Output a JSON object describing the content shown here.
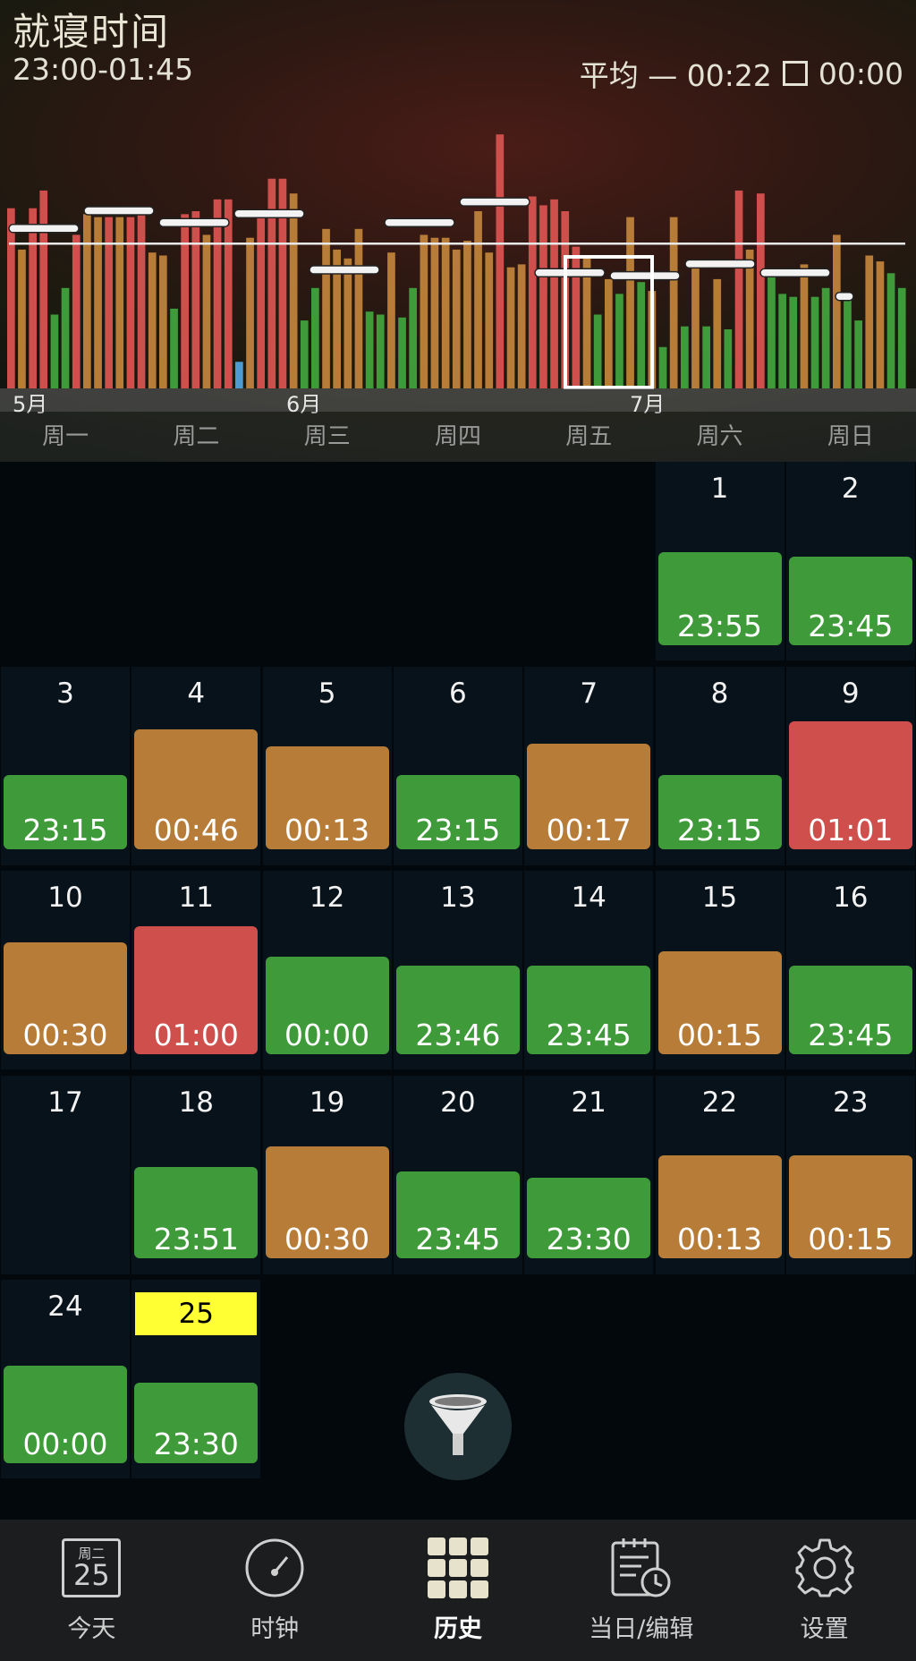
{
  "header": {
    "title": "就寝时间",
    "range": "23:00-01:45",
    "avg_label": "平均 — 00:22",
    "avg_check_value": "00:00"
  },
  "chart_data": {
    "type": "bar",
    "months": [
      "5月",
      "6月",
      "7月"
    ],
    "colors": {
      "green": "#3f9b3a",
      "orange": "#b67c38",
      "red": "#cf4f4c",
      "blue": "#4d9bd0"
    },
    "series": [
      {
        "c": "r",
        "v": 0.61
      },
      {
        "c": "o",
        "v": 0.47
      },
      {
        "c": "r",
        "v": 0.61
      },
      {
        "c": "r",
        "v": 0.67
      },
      {
        "c": "g",
        "v": 0.25
      },
      {
        "c": "g",
        "v": 0.34
      },
      {
        "c": "r",
        "v": 0.52
      },
      {
        "c": "o",
        "v": 0.59
      },
      {
        "c": "o",
        "v": 0.58
      },
      {
        "c": "r",
        "v": 0.58
      },
      {
        "c": "o",
        "v": 0.58
      },
      {
        "c": "r",
        "v": 0.58
      },
      {
        "c": "r",
        "v": 0.59
      },
      {
        "c": "o",
        "v": 0.46
      },
      {
        "c": "o",
        "v": 0.45
      },
      {
        "c": "g",
        "v": 0.27
      },
      {
        "c": "r",
        "v": 0.59
      },
      {
        "c": "r",
        "v": 0.6
      },
      {
        "c": "o",
        "v": 0.52
      },
      {
        "c": "r",
        "v": 0.64
      },
      {
        "c": "r",
        "v": 0.64
      },
      {
        "c": "b",
        "v": 0.09
      },
      {
        "c": "o",
        "v": 0.51
      },
      {
        "c": "r",
        "v": 0.58
      },
      {
        "c": "r",
        "v": 0.71
      },
      {
        "c": "r",
        "v": 0.71
      },
      {
        "c": "o",
        "v": 0.66
      },
      {
        "c": "g",
        "v": 0.23
      },
      {
        "c": "g",
        "v": 0.34
      },
      {
        "c": "o",
        "v": 0.54
      },
      {
        "c": "o",
        "v": 0.47
      },
      {
        "c": "o",
        "v": 0.44
      },
      {
        "c": "o",
        "v": 0.54
      },
      {
        "c": "g",
        "v": 0.26
      },
      {
        "c": "g",
        "v": 0.25
      },
      {
        "c": "o",
        "v": 0.46
      },
      {
        "c": "g",
        "v": 0.24
      },
      {
        "c": "g",
        "v": 0.34
      },
      {
        "c": "o",
        "v": 0.52
      },
      {
        "c": "o",
        "v": 0.51
      },
      {
        "c": "o",
        "v": 0.51
      },
      {
        "c": "o",
        "v": 0.47
      },
      {
        "c": "o",
        "v": 0.5
      },
      {
        "c": "o",
        "v": 0.6
      },
      {
        "c": "o",
        "v": 0.46
      },
      {
        "c": "r",
        "v": 0.86
      },
      {
        "c": "o",
        "v": 0.41
      },
      {
        "c": "o",
        "v": 0.42
      },
      {
        "c": "r",
        "v": 0.65
      },
      {
        "c": "r",
        "v": 0.62
      },
      {
        "c": "r",
        "v": 0.64
      },
      {
        "c": "r",
        "v": 0.6
      },
      {
        "c": "r",
        "v": 0.48
      },
      {
        "c": "o",
        "v": 0.44
      },
      {
        "c": "g",
        "v": 0.25
      },
      {
        "c": "o",
        "v": 0.37
      },
      {
        "c": "g",
        "v": 0.32
      },
      {
        "c": "o",
        "v": 0.58
      },
      {
        "c": "g",
        "v": 0.36
      },
      {
        "c": "o",
        "v": 0.33
      },
      {
        "c": "g",
        "v": 0.14
      },
      {
        "c": "o",
        "v": 0.58
      },
      {
        "c": "g",
        "v": 0.21
      },
      {
        "c": "o",
        "v": 0.41
      },
      {
        "c": "g",
        "v": 0.21
      },
      {
        "c": "o",
        "v": 0.37
      },
      {
        "c": "g",
        "v": 0.2
      },
      {
        "c": "r",
        "v": 0.67
      },
      {
        "c": "o",
        "v": 0.47
      },
      {
        "c": "r",
        "v": 0.66
      },
      {
        "c": "g",
        "v": 0.39
      },
      {
        "c": "g",
        "v": 0.32
      },
      {
        "c": "g",
        "v": 0.31
      },
      {
        "c": "o",
        "v": 0.42
      },
      {
        "c": "g",
        "v": 0.31
      },
      {
        "c": "g",
        "v": 0.34
      },
      {
        "c": "o",
        "v": 0.52
      },
      {
        "c": "g",
        "v": 0.3
      },
      {
        "c": "g",
        "v": 0.23
      },
      {
        "c": "o",
        "v": 0.45
      },
      {
        "c": "o",
        "v": 0.43
      },
      {
        "c": "g",
        "v": 0.39
      },
      {
        "c": "g",
        "v": 0.34
      }
    ],
    "weekly_avg": [
      0.54,
      0.6,
      0.56,
      0.59,
      0.4,
      0.56,
      0.63,
      0.39,
      0.38,
      0.42,
      0.39,
      0.31
    ],
    "overall_avg": 0.49,
    "selected_week_index": 7
  },
  "weekdays": [
    "周一",
    "周二",
    "周三",
    "周四",
    "周五",
    "周六",
    "周日"
  ],
  "calendar": {
    "days": [
      {
        "d": "1",
        "col": 5,
        "row": 0,
        "t": "23:55",
        "c": "green",
        "h": 0.28
      },
      {
        "d": "2",
        "col": 6,
        "row": 0,
        "t": "23:45",
        "c": "green",
        "h": 0.26
      },
      {
        "d": "3",
        "col": 0,
        "row": 1,
        "t": "23:15",
        "c": "green",
        "h": 0.19
      },
      {
        "d": "4",
        "col": 1,
        "row": 1,
        "t": "00:46",
        "c": "orange",
        "h": 0.41
      },
      {
        "d": "5",
        "col": 2,
        "row": 1,
        "t": "00:13",
        "c": "orange",
        "h": 0.33
      },
      {
        "d": "6",
        "col": 3,
        "row": 1,
        "t": "23:15",
        "c": "green",
        "h": 0.19
      },
      {
        "d": "7",
        "col": 4,
        "row": 1,
        "t": "00:17",
        "c": "orange",
        "h": 0.34
      },
      {
        "d": "8",
        "col": 5,
        "row": 1,
        "t": "23:15",
        "c": "green",
        "h": 0.19
      },
      {
        "d": "9",
        "col": 6,
        "row": 1,
        "t": "01:01",
        "c": "red",
        "h": 0.45
      },
      {
        "d": "10",
        "col": 0,
        "row": 2,
        "t": "00:30",
        "c": "orange",
        "h": 0.37
      },
      {
        "d": "11",
        "col": 1,
        "row": 2,
        "t": "01:00",
        "c": "red",
        "h": 0.45
      },
      {
        "d": "12",
        "col": 2,
        "row": 2,
        "t": "00:00",
        "c": "green",
        "h": 0.3
      },
      {
        "d": "13",
        "col": 3,
        "row": 2,
        "t": "23:46",
        "c": "green",
        "h": 0.26
      },
      {
        "d": "14",
        "col": 4,
        "row": 2,
        "t": "23:45",
        "c": "green",
        "h": 0.26
      },
      {
        "d": "15",
        "col": 5,
        "row": 2,
        "t": "00:15",
        "c": "orange",
        "h": 0.33
      },
      {
        "d": "16",
        "col": 6,
        "row": 2,
        "t": "23:45",
        "c": "green",
        "h": 0.26
      },
      {
        "d": "17",
        "col": 0,
        "row": 3,
        "t": "",
        "c": "",
        "h": 0
      },
      {
        "d": "18",
        "col": 1,
        "row": 3,
        "t": "23:51",
        "c": "green",
        "h": 0.27
      },
      {
        "d": "19",
        "col": 2,
        "row": 3,
        "t": "00:30",
        "c": "orange",
        "h": 0.37
      },
      {
        "d": "20",
        "col": 3,
        "row": 3,
        "t": "23:45",
        "c": "green",
        "h": 0.25
      },
      {
        "d": "21",
        "col": 4,
        "row": 3,
        "t": "23:30",
        "c": "green",
        "h": 0.22
      },
      {
        "d": "22",
        "col": 5,
        "row": 3,
        "t": "00:13",
        "c": "orange",
        "h": 0.33
      },
      {
        "d": "23",
        "col": 6,
        "row": 3,
        "t": "00:15",
        "c": "orange",
        "h": 0.33
      },
      {
        "d": "24",
        "col": 0,
        "row": 4,
        "t": "00:00",
        "c": "green",
        "h": 0.3
      },
      {
        "d": "25",
        "col": 1,
        "row": 4,
        "t": "23:30",
        "c": "green",
        "h": 0.22,
        "today": true
      }
    ]
  },
  "filter": {
    "icon": "funnel-icon"
  },
  "tabbar": {
    "tabs": [
      {
        "label": "今天",
        "icon": "calendar-day-icon",
        "icon_top": "周二",
        "icon_num": "25"
      },
      {
        "label": "时钟",
        "icon": "clock-gauge-icon"
      },
      {
        "label": "历史",
        "icon": "grid-icon",
        "active": true
      },
      {
        "label": "当日/编辑",
        "icon": "schedule-edit-icon"
      },
      {
        "label": "设置",
        "icon": "gear-icon"
      }
    ]
  }
}
